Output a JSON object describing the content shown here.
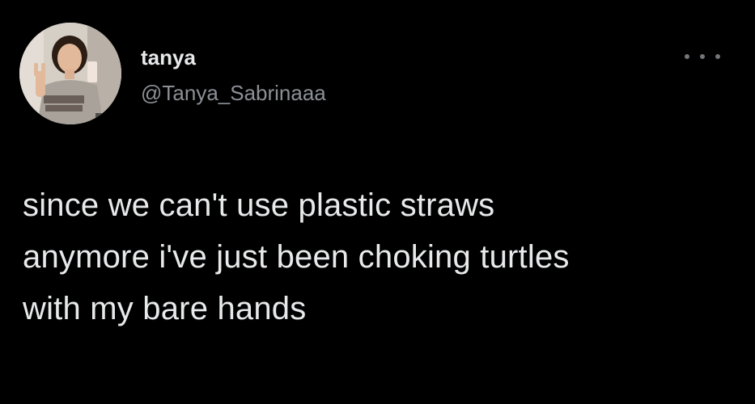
{
  "tweet": {
    "author": {
      "display_name": "tanya",
      "handle": "@Tanya_Sabrinaaa"
    },
    "text_lines": [
      "since we can't use plastic straws",
      "anymore i've just been choking turtles",
      "with my bare hands"
    ],
    "more_icon": "ellipsis-icon"
  },
  "colors": {
    "background": "#000000",
    "text": "#e7e9ea",
    "secondary_text": "#8b9096"
  }
}
